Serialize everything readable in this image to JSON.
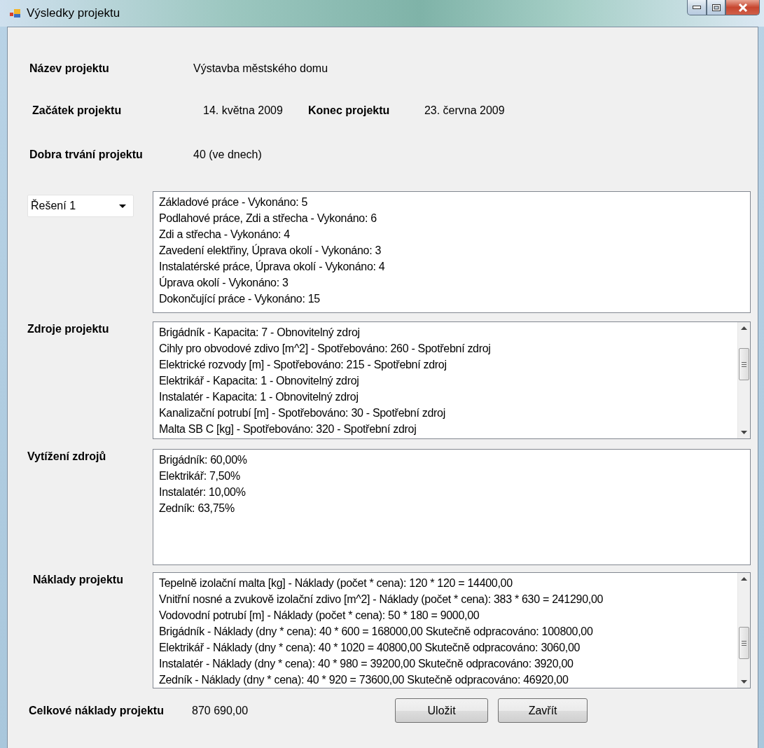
{
  "window": {
    "title": "Výsledky projektu"
  },
  "info_rows": [
    {
      "pairs": [
        {
          "label": "Název projektu",
          "value": "Výstavba městského domu"
        }
      ]
    },
    {
      "pairs": [
        {
          "label": "Začátek projektu",
          "value": "14. května 2009"
        },
        {
          "label": "Konec projektu",
          "value": "23. června 2009"
        }
      ]
    },
    {
      "pairs": [
        {
          "label": "Dobra trvání projektu",
          "value": "40 (ve dnech)"
        }
      ]
    }
  ],
  "solution_select": {
    "value": "Řešení 1"
  },
  "activities": {
    "scrollable": false,
    "lines": [
      "Základové práce  - Vykonáno: 5",
      "Podlahové práce, Zdi a střecha  - Vykonáno: 6",
      "Zdi a střecha  - Vykonáno: 4",
      "Zavedení elektřiny, Úprava okolí  - Vykonáno: 3",
      "Instalatérské práce, Úprava okolí  - Vykonáno: 4",
      "Úprava okolí  - Vykonáno: 3",
      "Dokončující práce  - Vykonáno: 15"
    ]
  },
  "sections": [
    {
      "label": "Zdroje projektu",
      "scrollable": true,
      "lines": [
        "Brigádník - Kapacita: 7 - Obnovitelný zdroj",
        "Cihly pro obvodové zdivo [m^2] - Spotřebováno: 260 - Spotřební zdroj",
        "Elektrické rozvody [m] - Spotřebováno: 215 - Spotřební zdroj",
        "Elektrikář - Kapacita: 1 - Obnovitelný zdroj",
        "Instalatér - Kapacita: 1 - Obnovitelný zdroj",
        "Kanalizační potrubí [m] - Spotřebováno: 30 - Spotřební zdroj",
        "Malta SB C [kg] - Spotřebováno: 320 - Spotřební zdroj"
      ]
    },
    {
      "label": "Vytížení zdrojů",
      "scrollable": false,
      "lines": [
        "Brigádník: 60,00%",
        "Elektrikář: 7,50%",
        "Instalatér: 10,00%",
        "Zedník: 63,75%"
      ]
    },
    {
      "label": "Náklady projektu",
      "scrollable": true,
      "lines": [
        "Tepelně izolační malta [kg] - Náklady (počet * cena): 120 * 120 = 14400,00",
        "Vnitřní nosné a zvukově izolační zdivo [m^2] - Náklady (počet * cena): 383 * 630 = 241290,00",
        "Vodovodní potrubí [m] - Náklady (počet * cena): 50 * 180 = 9000,00",
        "Brigádník - Náklady (dny * cena): 40 * 600 = 168000,00 Skutečně odpracováno: 100800,00",
        "Elektrikář - Náklady (dny * cena): 40 * 1020 = 40800,00 Skutečně odpracováno: 3060,00",
        "Instalatér - Náklady (dny * cena): 40 * 980 = 39200,00 Skutečně odpracováno: 3920,00",
        "Zedník - Náklady (dny * cena): 40 * 920 = 73600,00 Skutečně odpracováno: 46920,00"
      ]
    }
  ],
  "total": {
    "label": "Celkové náklady projektu",
    "value": "870 690,00"
  },
  "buttons": [
    "Uložit",
    "Zavřít"
  ]
}
